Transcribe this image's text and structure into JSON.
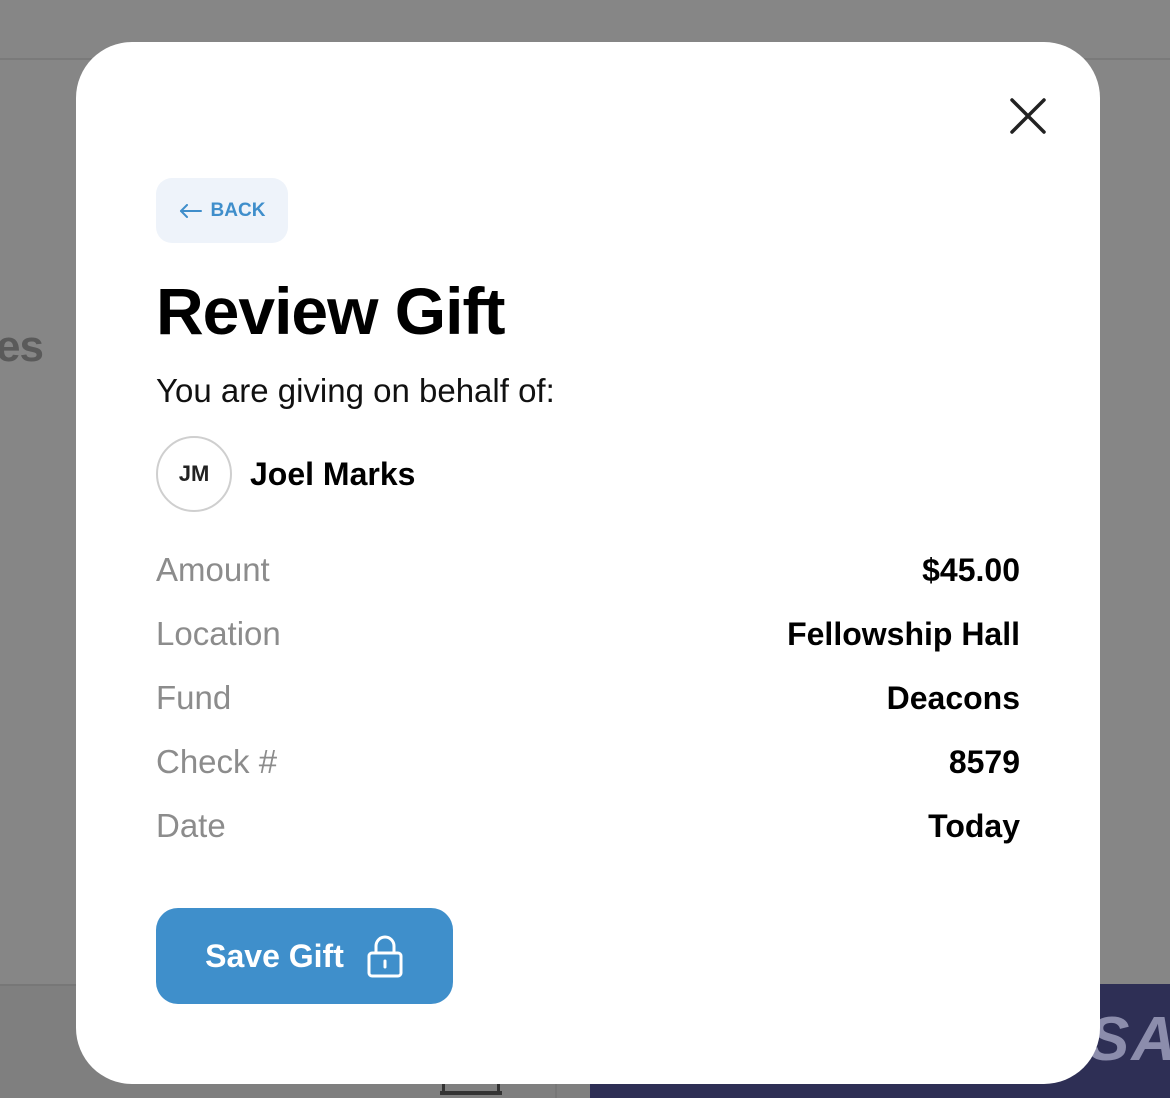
{
  "background": {
    "partial_heading": "es",
    "card_brand": "SA"
  },
  "modal": {
    "back_label": "BACK",
    "title": "Review Gift",
    "subtitle": "You are giving on behalf of:",
    "donor": {
      "initials": "JM",
      "name": "Joel Marks"
    },
    "details": [
      {
        "label": "Amount",
        "value": "$45.00"
      },
      {
        "label": "Location",
        "value": "Fellowship Hall"
      },
      {
        "label": "Fund",
        "value": "Deacons"
      },
      {
        "label": "Check #",
        "value": "8579"
      },
      {
        "label": "Date",
        "value": "Today"
      }
    ],
    "save_label": "Save Gift"
  },
  "icons": {
    "close": "close-icon",
    "back": "arrow-left-icon",
    "save": "lock-icon"
  },
  "colors": {
    "accent": "#3f8fcb",
    "back_bg": "#eef3fa",
    "overlay": "#868686",
    "label_gray": "#8c8c8c"
  }
}
